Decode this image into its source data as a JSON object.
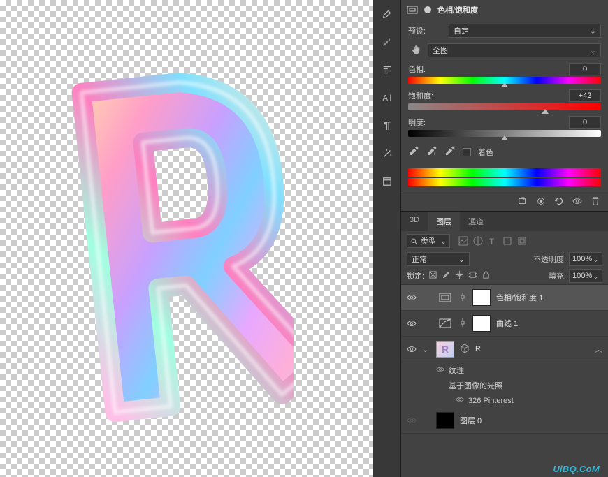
{
  "adjustment": {
    "title": "色相/饱和度",
    "preset_label": "预设:",
    "preset_value": "自定",
    "channel": "全图",
    "sliders": {
      "hue": {
        "label": "色相:",
        "value": "0",
        "pos": 50
      },
      "saturation": {
        "label": "饱和度:",
        "value": "+42",
        "pos": 71
      },
      "lightness": {
        "label": "明度:",
        "value": "0",
        "pos": 50
      }
    },
    "colorize_label": "着色"
  },
  "tabs": {
    "t3d": "3D",
    "layers": "图层",
    "channels": "通道"
  },
  "layer_panel": {
    "filter_label": "类型",
    "blend_mode": "正常",
    "opacity_label": "不透明度:",
    "opacity_value": "100%",
    "lock_label": "锁定:",
    "fill_label": "填充:",
    "fill_value": "100%"
  },
  "layers": [
    {
      "name": "色相/饱和度 1",
      "type": "adj_hs"
    },
    {
      "name": "曲线 1",
      "type": "adj_curve"
    },
    {
      "name": "R",
      "type": "3d"
    },
    {
      "name": "图层 0",
      "type": "raster_black"
    }
  ],
  "sublayers": {
    "texture": "纹理",
    "line1": "基于图像的光照",
    "line2": "326 Pinterest"
  },
  "watermark": "UiBQ.CoM"
}
